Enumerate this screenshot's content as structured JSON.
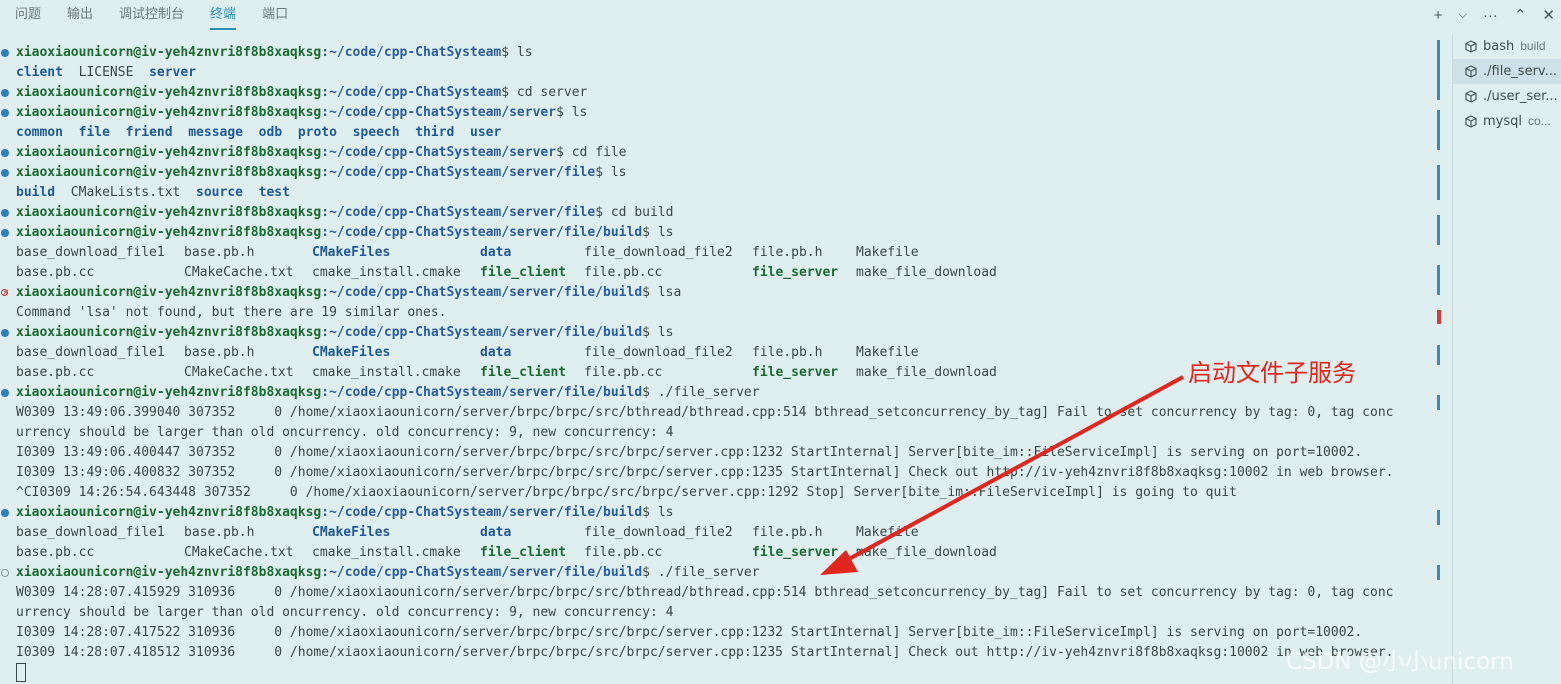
{
  "tabs": [
    "问题",
    "输出",
    "调试控制台",
    "终端",
    "端口"
  ],
  "active_tab": 3,
  "window_actions": {
    "add": "+",
    "add_dropdown": "⌵",
    "more": "···",
    "maximize": "⌃",
    "close": "✕"
  },
  "prompt_user": "xiaoxiaounicorn@iv-yeh4znvri8f8b8xaqksg",
  "terminal_lines": [
    {
      "type": "cmd",
      "status": "ok",
      "path": ":~/code/cpp-ChatSysteam",
      "cmd": "ls"
    },
    {
      "type": "ls",
      "items": [
        {
          "t": "client",
          "k": "dir"
        },
        {
          "t": "LICENSE",
          "k": "file"
        },
        {
          "t": "server",
          "k": "dir"
        }
      ]
    },
    {
      "type": "cmd",
      "status": "ok",
      "path": ":~/code/cpp-ChatSysteam",
      "cmd": "cd server"
    },
    {
      "type": "cmd",
      "status": "ok",
      "path": ":~/code/cpp-ChatSysteam/server",
      "cmd": "ls"
    },
    {
      "type": "ls",
      "items": [
        {
          "t": "common",
          "k": "dir"
        },
        {
          "t": "file",
          "k": "dir"
        },
        {
          "t": "friend",
          "k": "dir"
        },
        {
          "t": "message",
          "k": "dir"
        },
        {
          "t": "odb",
          "k": "dir"
        },
        {
          "t": "proto",
          "k": "dir"
        },
        {
          "t": "speech",
          "k": "dir"
        },
        {
          "t": "third",
          "k": "dir"
        },
        {
          "t": "user",
          "k": "dir"
        }
      ]
    },
    {
      "type": "cmd",
      "status": "ok",
      "path": ":~/code/cpp-ChatSysteam/server",
      "cmd": "cd file"
    },
    {
      "type": "cmd",
      "status": "ok",
      "path": ":~/code/cpp-ChatSysteam/server/file",
      "cmd": "ls"
    },
    {
      "type": "ls",
      "items": [
        {
          "t": "build",
          "k": "dir"
        },
        {
          "t": "CMakeLists.txt",
          "k": "file"
        },
        {
          "t": "source",
          "k": "dir"
        },
        {
          "t": "test",
          "k": "dir"
        }
      ]
    },
    {
      "type": "cmd",
      "status": "ok",
      "path": ":~/code/cpp-ChatSysteam/server/file",
      "cmd": "cd build"
    },
    {
      "type": "cmd",
      "status": "ok",
      "path": ":~/code/cpp-ChatSysteam/server/file/build",
      "cmd": "ls"
    },
    {
      "type": "grid",
      "items": [
        {
          "t": "base_download_file1",
          "k": "file"
        },
        {
          "t": "base.pb.h",
          "k": "file"
        },
        {
          "t": "CMakeFiles",
          "k": "dir"
        },
        {
          "t": "data",
          "k": "dir"
        },
        {
          "t": "file_download_file2",
          "k": "file"
        },
        {
          "t": "file.pb.h",
          "k": "file"
        },
        {
          "t": "Makefile",
          "k": "file"
        }
      ]
    },
    {
      "type": "grid",
      "items": [
        {
          "t": "base.pb.cc",
          "k": "file"
        },
        {
          "t": "CMakeCache.txt",
          "k": "file"
        },
        {
          "t": "cmake_install.cmake",
          "k": "file"
        },
        {
          "t": "file_client",
          "k": "exe"
        },
        {
          "t": "file.pb.cc",
          "k": "file"
        },
        {
          "t": "file_server",
          "k": "exe"
        },
        {
          "t": "make_file_download",
          "k": "file"
        }
      ]
    },
    {
      "type": "cmd",
      "status": "err",
      "path": ":~/code/cpp-ChatSysteam/server/file/build",
      "cmd": "lsa"
    },
    {
      "type": "text",
      "text": "Command 'lsa' not found, but there are 19 similar ones."
    },
    {
      "type": "cmd",
      "status": "ok",
      "path": ":~/code/cpp-ChatSysteam/server/file/build",
      "cmd": "ls"
    },
    {
      "type": "grid",
      "items": [
        {
          "t": "base_download_file1",
          "k": "file"
        },
        {
          "t": "base.pb.h",
          "k": "file"
        },
        {
          "t": "CMakeFiles",
          "k": "dir"
        },
        {
          "t": "data",
          "k": "dir"
        },
        {
          "t": "file_download_file2",
          "k": "file"
        },
        {
          "t": "file.pb.h",
          "k": "file"
        },
        {
          "t": "Makefile",
          "k": "file"
        }
      ]
    },
    {
      "type": "grid",
      "items": [
        {
          "t": "base.pb.cc",
          "k": "file"
        },
        {
          "t": "CMakeCache.txt",
          "k": "file"
        },
        {
          "t": "cmake_install.cmake",
          "k": "file"
        },
        {
          "t": "file_client",
          "k": "exe"
        },
        {
          "t": "file.pb.cc",
          "k": "file"
        },
        {
          "t": "file_server",
          "k": "exe"
        },
        {
          "t": "make_file_download",
          "k": "file"
        }
      ]
    },
    {
      "type": "cmd",
      "status": "ok",
      "path": ":~/code/cpp-ChatSysteam/server/file/build",
      "cmd": "./file_server"
    },
    {
      "type": "text",
      "text": "W0309 13:49:06.399040 307352     0 /home/xiaoxiaounicorn/server/brpc/brpc/src/bthread/bthread.cpp:514 bthread_setconcurrency_by_tag] Fail to set concurrency by tag: 0, tag conc"
    },
    {
      "type": "text",
      "text": "urrency should be larger than old oncurrency. old concurrency: 9, new concurrency: 4"
    },
    {
      "type": "text",
      "text": "I0309 13:49:06.400447 307352     0 /home/xiaoxiaounicorn/server/brpc/brpc/src/brpc/server.cpp:1232 StartInternal] Server[bite_im::FileServiceImpl] is serving on port=10002."
    },
    {
      "type": "text",
      "text": "I0309 13:49:06.400832 307352     0 /home/xiaoxiaounicorn/server/brpc/brpc/src/brpc/server.cpp:1235 StartInternal] Check out http://iv-yeh4znvri8f8b8xaqksg:10002 in web browser."
    },
    {
      "type": "text",
      "text": "^CI0309 14:26:54.643448 307352     0 /home/xiaoxiaounicorn/server/brpc/brpc/src/brpc/server.cpp:1292 Stop] Server[bite_im::FileServiceImpl] is going to quit"
    },
    {
      "type": "cmd",
      "status": "ok",
      "path": ":~/code/cpp-ChatSysteam/server/file/build",
      "cmd": "ls"
    },
    {
      "type": "grid",
      "items": [
        {
          "t": "base_download_file1",
          "k": "file"
        },
        {
          "t": "base.pb.h",
          "k": "file"
        },
        {
          "t": "CMakeFiles",
          "k": "dir"
        },
        {
          "t": "data",
          "k": "dir"
        },
        {
          "t": "file_download_file2",
          "k": "file"
        },
        {
          "t": "file.pb.h",
          "k": "file"
        },
        {
          "t": "Makefile",
          "k": "file"
        }
      ]
    },
    {
      "type": "grid",
      "items": [
        {
          "t": "base.pb.cc",
          "k": "file"
        },
        {
          "t": "CMakeCache.txt",
          "k": "file"
        },
        {
          "t": "cmake_install.cmake",
          "k": "file"
        },
        {
          "t": "file_client",
          "k": "exe"
        },
        {
          "t": "file.pb.cc",
          "k": "file"
        },
        {
          "t": "file_server",
          "k": "exe"
        },
        {
          "t": "make_file_download",
          "k": "file"
        }
      ]
    },
    {
      "type": "cmd",
      "status": "none",
      "path": ":~/code/cpp-ChatSysteam/server/file/build",
      "cmd": "./file_server"
    },
    {
      "type": "text",
      "text": "W0309 14:28:07.415929 310936     0 /home/xiaoxiaounicorn/server/brpc/brpc/src/bthread/bthread.cpp:514 bthread_setconcurrency_by_tag] Fail to set concurrency by tag: 0, tag conc"
    },
    {
      "type": "text",
      "text": "urrency should be larger than old oncurrency. old concurrency: 9, new concurrency: 4"
    },
    {
      "type": "text",
      "text": "I0309 14:28:07.417522 310936     0 /home/xiaoxiaounicorn/server/brpc/brpc/src/brpc/server.cpp:1232 StartInternal] Server[bite_im::FileServiceImpl] is serving on port=10002."
    },
    {
      "type": "text",
      "text": "I0309 14:28:07.418512 310936     0 /home/xiaoxiaounicorn/server/brpc/brpc/src/brpc/server.cpp:1235 StartInternal] Check out http://iv-yeh4znvri8f8b8xaqksg:10002 in web browser."
    },
    {
      "type": "cursor"
    }
  ],
  "terminal_list": [
    {
      "name": "bash",
      "sub": "build",
      "selected": false
    },
    {
      "name": "./file_serv...",
      "sub": "",
      "selected": true
    },
    {
      "name": "./user_ser...",
      "sub": "",
      "selected": false
    },
    {
      "name": "mysql",
      "sub": "co...",
      "selected": false
    }
  ],
  "annotation": "启动文件子服务",
  "watermark": "CSDN @小小unicorn",
  "colors": {
    "background": "#dfeeee",
    "prompt": "#1b6a33",
    "dir": "#1f5a98",
    "accent": "#2d8fb3",
    "annotation": "#e0261f"
  }
}
